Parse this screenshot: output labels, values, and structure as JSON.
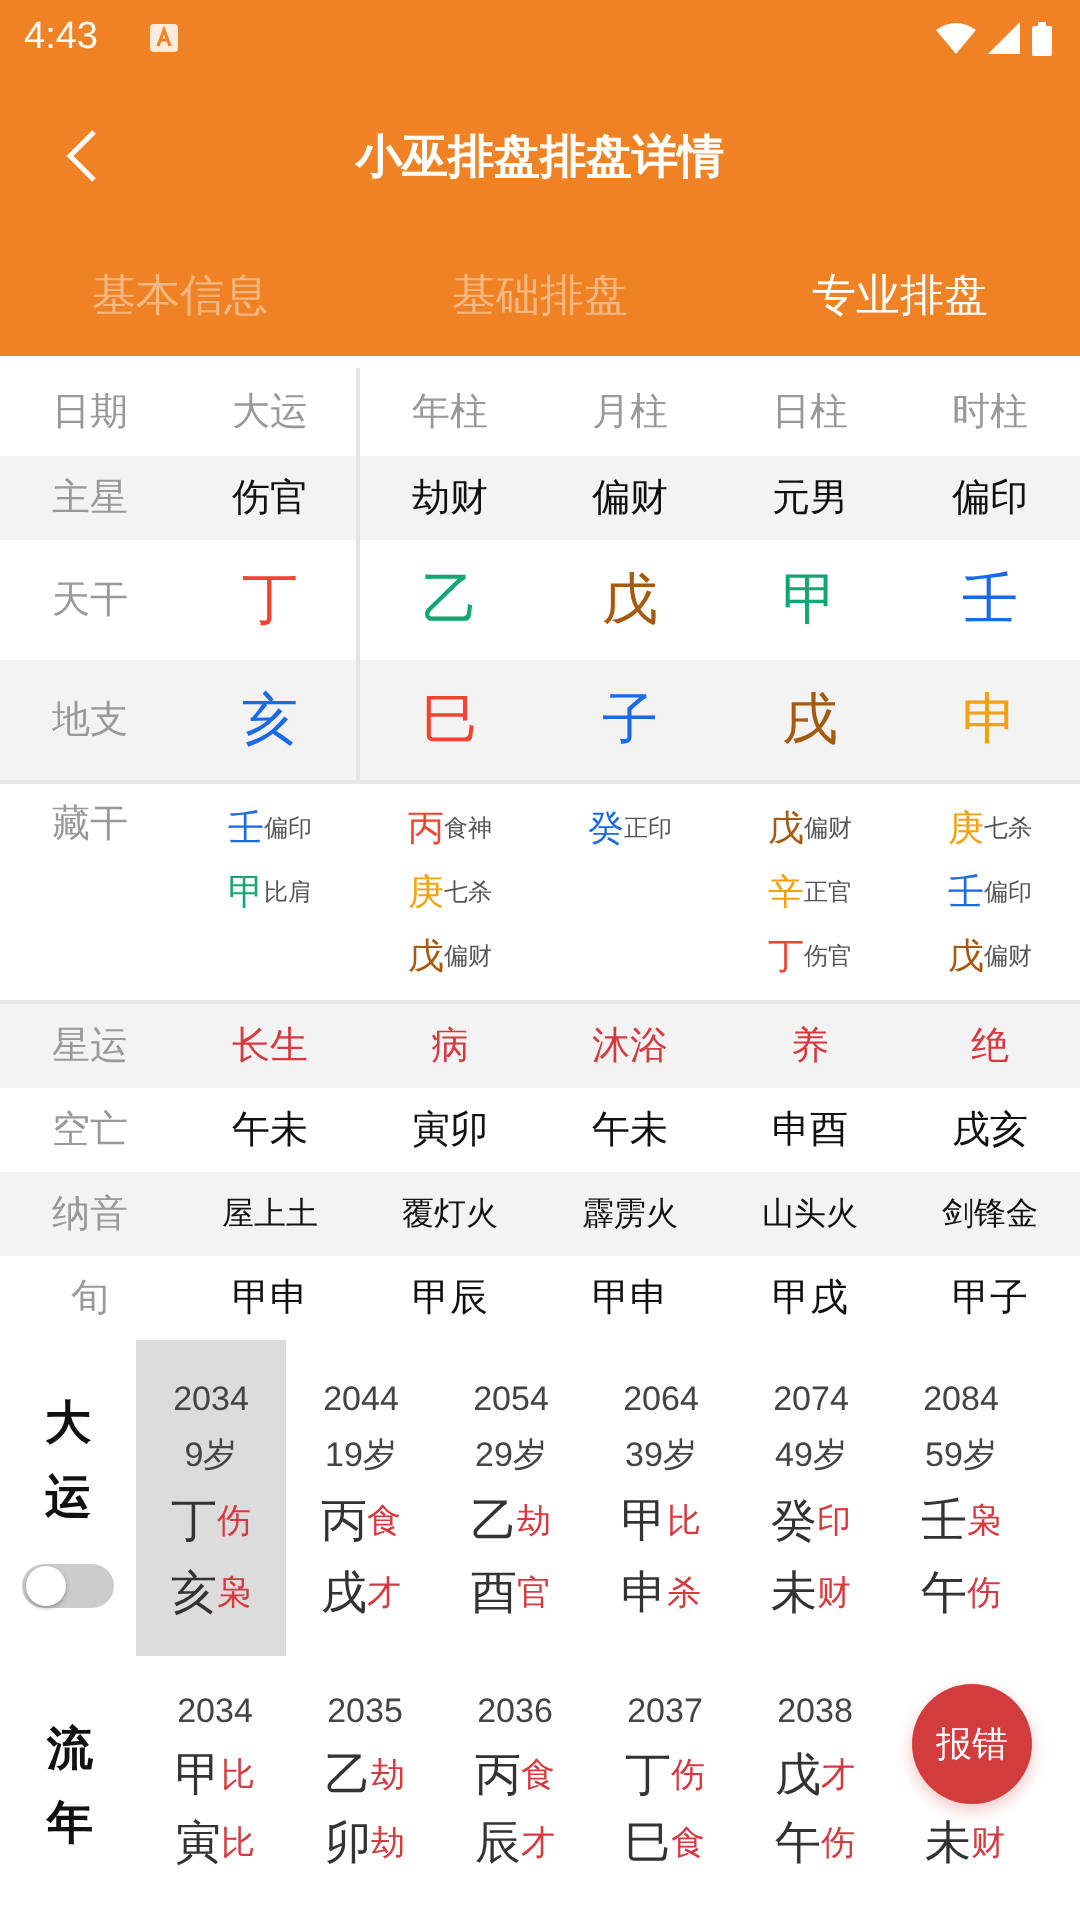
{
  "status_bar": {
    "time": "4:43"
  },
  "toolbar": {
    "title": "小巫排盘排盘详情"
  },
  "tabs": [
    {
      "label": "基本信息",
      "selected": false
    },
    {
      "label": "基础排盘",
      "selected": false
    },
    {
      "label": "专业排盘",
      "selected": true
    }
  ],
  "chart": {
    "columns": [
      "日期",
      "大运",
      "年柱",
      "月柱",
      "日柱",
      "时柱"
    ],
    "rows": [
      {
        "kind": "text",
        "cells": [
          "主星",
          "伤官",
          "劫财",
          "偏财",
          "元男",
          "偏印"
        ]
      },
      {
        "kind": "char",
        "cells": [
          "天干",
          {
            "text": "丁",
            "color": "#f0442e"
          },
          {
            "text": "乙",
            "color": "#10a870"
          },
          {
            "text": "戊",
            "color": "#a55a10"
          },
          {
            "text": "甲",
            "color": "#10a870"
          },
          {
            "text": "壬",
            "color": "#1a6ae8"
          }
        ]
      },
      {
        "kind": "char",
        "cells": [
          "地支",
          {
            "text": "亥",
            "color": "#1a6ae8"
          },
          {
            "text": "巳",
            "color": "#f0442e"
          },
          {
            "text": "子",
            "color": "#1a6ae8"
          },
          {
            "text": "戌",
            "color": "#a55a10"
          },
          {
            "text": "申",
            "color": "#f5a00f"
          }
        ]
      },
      {
        "kind": "hidden",
        "cells": [
          "藏干",
          [
            {
              "stem": "壬",
              "color": "#1a6ae8",
              "god": "偏印"
            },
            {
              "stem": "甲",
              "color": "#10a870",
              "god": "比肩"
            }
          ],
          [
            {
              "stem": "丙",
              "color": "#f0442e",
              "god": "食神"
            },
            {
              "stem": "庚",
              "color": "#f5a00f",
              "god": "七杀"
            },
            {
              "stem": "戊",
              "color": "#a55a10",
              "god": "偏财"
            }
          ],
          [
            {
              "stem": "癸",
              "color": "#1a6ae8",
              "god": "正印"
            }
          ],
          [
            {
              "stem": "戊",
              "color": "#a55a10",
              "god": "偏财"
            },
            {
              "stem": "辛",
              "color": "#f5a00f",
              "god": "正官"
            },
            {
              "stem": "丁",
              "color": "#f0442e",
              "god": "伤官"
            }
          ],
          [
            {
              "stem": "庚",
              "color": "#f5a00f",
              "god": "七杀"
            },
            {
              "stem": "壬",
              "color": "#1a6ae8",
              "god": "偏印"
            },
            {
              "stem": "戊",
              "color": "#a55a10",
              "god": "偏财"
            }
          ]
        ]
      },
      {
        "kind": "stage",
        "cells": [
          "星运",
          "长生",
          "病",
          "沐浴",
          "养",
          "绝"
        ]
      },
      {
        "kind": "text",
        "cells": [
          "空亡",
          "午未",
          "寅卯",
          "午未",
          "申酉",
          "戌亥"
        ]
      },
      {
        "kind": "small",
        "cells": [
          "纳音",
          "屋上土",
          "覆灯火",
          "霹雳火",
          "山头火",
          "剑锋金"
        ]
      },
      {
        "kind": "text",
        "cells": [
          "旬",
          "甲申",
          "甲辰",
          "甲申",
          "甲戌",
          "甲子"
        ]
      }
    ]
  },
  "dayun": {
    "label": "大运",
    "toggle_on": false,
    "items": [
      {
        "year": "2034",
        "age": "9岁",
        "stem": "丁",
        "stem_god": "伤",
        "branch": "亥",
        "branch_god": "枭",
        "selected": true
      },
      {
        "year": "2044",
        "age": "19岁",
        "stem": "丙",
        "stem_god": "食",
        "branch": "戌",
        "branch_god": "才",
        "selected": false
      },
      {
        "year": "2054",
        "age": "29岁",
        "stem": "乙",
        "stem_god": "劫",
        "branch": "酉",
        "branch_god": "官",
        "selected": false
      },
      {
        "year": "2064",
        "age": "39岁",
        "stem": "甲",
        "stem_god": "比",
        "branch": "申",
        "branch_god": "杀",
        "selected": false
      },
      {
        "year": "2074",
        "age": "49岁",
        "stem": "癸",
        "stem_god": "印",
        "branch": "未",
        "branch_god": "财",
        "selected": false
      },
      {
        "year": "2084",
        "age": "59岁",
        "stem": "壬",
        "stem_god": "枭",
        "branch": "午",
        "branch_god": "伤",
        "selected": false
      }
    ]
  },
  "liunian": {
    "label": "流年",
    "items": [
      {
        "year": "2034",
        "stem": "甲",
        "stem_god": "比",
        "branch": "寅",
        "branch_god": "比"
      },
      {
        "year": "2035",
        "stem": "乙",
        "stem_god": "劫",
        "branch": "卯",
        "branch_god": "劫"
      },
      {
        "year": "2036",
        "stem": "丙",
        "stem_god": "食",
        "branch": "辰",
        "branch_god": "才"
      },
      {
        "year": "2037",
        "stem": "丁",
        "stem_god": "伤",
        "branch": "巳",
        "branch_god": "食"
      },
      {
        "year": "2038",
        "stem": "戊",
        "stem_god": "才",
        "branch": "午",
        "branch_god": "伤"
      },
      {
        "branch": "未",
        "branch_god": "财"
      }
    ]
  },
  "fab": {
    "label": "报错"
  }
}
